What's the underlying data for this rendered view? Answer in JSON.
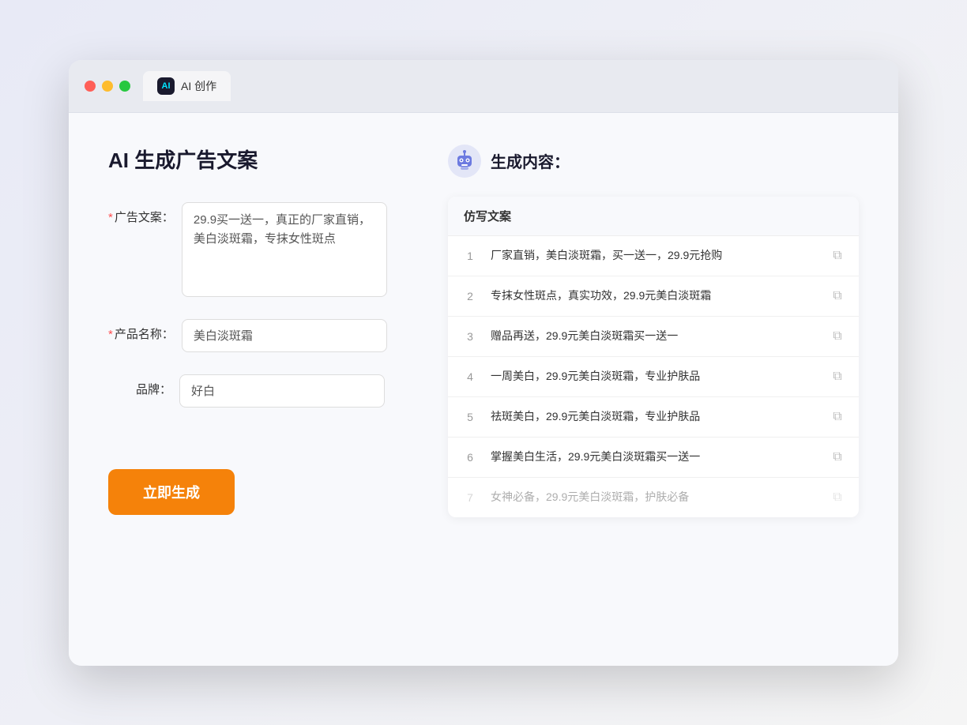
{
  "window": {
    "tab_label": "AI 创作",
    "tab_icon": "AI"
  },
  "left": {
    "title": "AI 生成广告文案",
    "ad_copy_label": "广告文案：",
    "ad_copy_value": "29.9买一送一，真正的厂家直销，美白淡斑霜，专抹女性斑点",
    "product_name_label": "产品名称：",
    "product_name_value": "美白淡斑霜",
    "brand_label": "品牌：",
    "brand_value": "好白",
    "generate_btn_label": "立即生成"
  },
  "right": {
    "header_label": "生成内容：",
    "table_col_label": "仿写文案",
    "rows": [
      {
        "num": "1",
        "text": "厂家直销，美白淡斑霜，买一送一，29.9元抢购",
        "faded": false
      },
      {
        "num": "2",
        "text": "专抹女性斑点，真实功效，29.9元美白淡斑霜",
        "faded": false
      },
      {
        "num": "3",
        "text": "赠品再送，29.9元美白淡斑霜买一送一",
        "faded": false
      },
      {
        "num": "4",
        "text": "一周美白，29.9元美白淡斑霜，专业护肤品",
        "faded": false
      },
      {
        "num": "5",
        "text": "祛斑美白，29.9元美白淡斑霜，专业护肤品",
        "faded": false
      },
      {
        "num": "6",
        "text": "掌握美白生活，29.9元美白淡斑霜买一送一",
        "faded": false
      },
      {
        "num": "7",
        "text": "女神必备，29.9元美白淡斑霜，护肤必备",
        "faded": true
      }
    ]
  }
}
